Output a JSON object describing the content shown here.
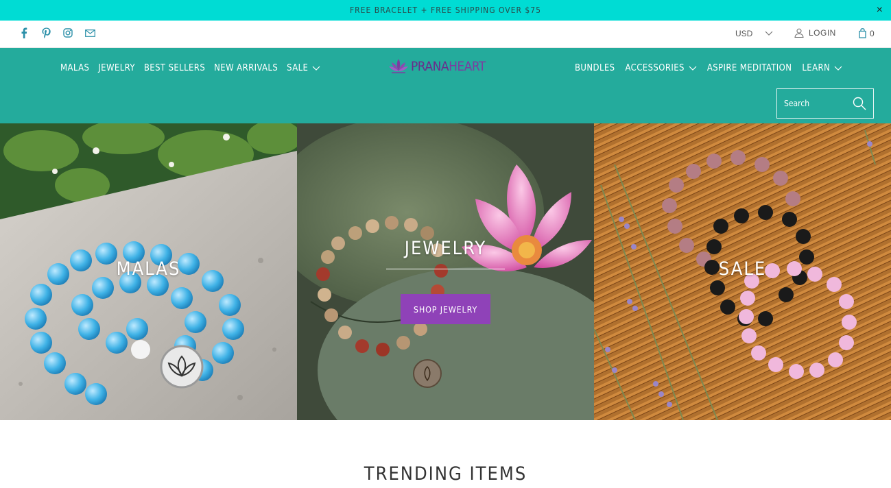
{
  "promo": {
    "text": "FREE BRACELET + FREE SHIPPING OVER $75",
    "close_label": "×"
  },
  "utility": {
    "social_icons": [
      "facebook-icon",
      "pinterest-icon",
      "instagram-icon",
      "email-icon"
    ],
    "currency": "USD",
    "login_label": "LOGIN",
    "cart_count": "0"
  },
  "nav": {
    "left": [
      {
        "label": "MALAS"
      },
      {
        "label": "JEWELRY"
      },
      {
        "label": "BEST SELLERS"
      },
      {
        "label": "NEW ARRIVALS"
      },
      {
        "label": "SALE"
      }
    ],
    "right": [
      {
        "label": "BUNDLES"
      },
      {
        "label": "ACCESSORIES"
      },
      {
        "label": "ASPIRE MEDITATION"
      },
      {
        "label": "LEARN"
      }
    ],
    "logo": {
      "part1": "PRANA",
      "part2": "HEART"
    },
    "search_placeholder": "Search"
  },
  "hero": {
    "panels": [
      {
        "title": "MALAS"
      },
      {
        "title": "JEWELRY",
        "button": "SHOP JEWELRY"
      },
      {
        "title": "SALE"
      }
    ]
  },
  "sections": {
    "trending_title": "TRENDING ITEMS"
  },
  "colors": {
    "promo_bg": "#00dcd4",
    "nav_bg": "#24ab9c",
    "button_purple": "#8f42b8",
    "logo_purple": "#6a2d8c"
  }
}
